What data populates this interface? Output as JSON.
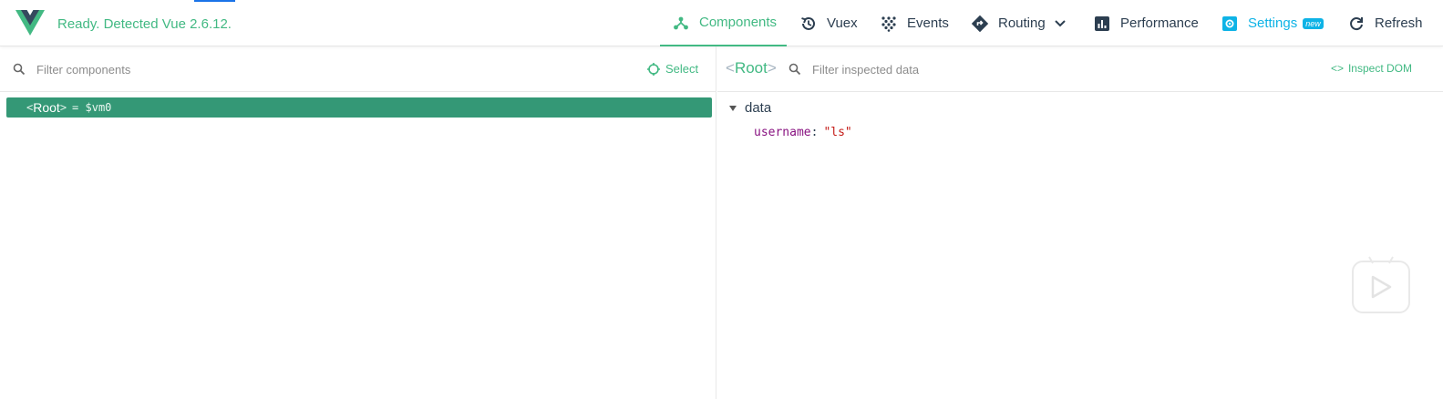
{
  "header": {
    "status": "Ready. Detected Vue 2.6.12.",
    "nav": {
      "components": "Components",
      "vuex": "Vuex",
      "events": "Events",
      "routing": "Routing",
      "performance": "Performance",
      "settings": "Settings",
      "settings_badge": "new",
      "refresh": "Refresh"
    }
  },
  "components_panel": {
    "filter_placeholder": "Filter components",
    "select_label": "Select",
    "tree": [
      {
        "open": "<",
        "name": "Root",
        "close": ">",
        "ref": "= $vm0",
        "selected": true
      }
    ]
  },
  "inspector": {
    "title_open": "<",
    "title_name": "Root",
    "title_close": ">",
    "filter_placeholder": "Filter inspected data",
    "inspect_dom_label": "Inspect DOM",
    "section_label": "data",
    "fields": [
      {
        "key": "username",
        "value": "\"ls\""
      }
    ]
  },
  "colors": {
    "vue_green": "#42b983",
    "selected_row": "#349876",
    "settings_blue": "#0eb3e6"
  },
  "icons": {
    "logo": "vue-logo",
    "components": "components-tree-icon",
    "vuex": "history-icon",
    "events": "events-dots-icon",
    "routing": "routing-diamond-icon",
    "performance": "bar-chart-icon",
    "settings": "gear-icon",
    "refresh": "refresh-icon",
    "search": "search-icon",
    "select": "target-icon",
    "inspect_dom": "code-icon",
    "overlay": "play-icon"
  }
}
